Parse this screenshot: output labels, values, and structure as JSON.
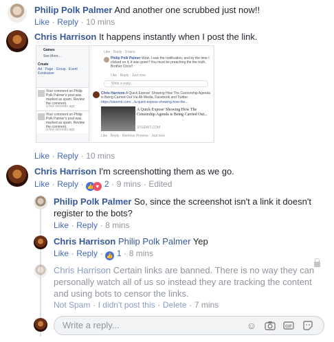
{
  "comments": [
    {
      "author": "Philip Polk Palmer",
      "text": "And another one scrubbed just now!!",
      "like": "Like",
      "reply": "Reply",
      "sep": "·",
      "time": "10 mins"
    },
    {
      "author": "Chris Harrison",
      "text": "It happens instantly when I post the link.",
      "like": "Like",
      "reply": "Reply",
      "sep": "·",
      "time": "10 mins"
    },
    {
      "author": "Chris Harrison",
      "text": "I'm screenshotting them as we go.",
      "like": "Like",
      "reply": "Reply",
      "sep": "·",
      "reactions": "2",
      "time": "9 mins",
      "edited": "Edited"
    }
  ],
  "replies": [
    {
      "author": "Philip Polk Palmer",
      "text_line1": "So, since the screenshot isn't a link it doesn't",
      "text_line2": "register to the bots?",
      "like": "Like",
      "reply": "Reply",
      "sep": "·",
      "time": "8 mins"
    },
    {
      "author": "Chris Harrison",
      "mention": "Philip Polk Palmer",
      "text": "Yep",
      "like": "Like",
      "reply": "Reply",
      "sep": "·",
      "reactions": "1",
      "time": "8 mins"
    },
    {
      "author": "Chris Harrison",
      "text_line1": "Certain links are banned. There is no way they can",
      "text_line2": "personally watch all of us so instead they are tracking the content",
      "text_line3": "and using bots to censor the links.",
      "not_spam": "Not Spam",
      "didnt_post": "I didn't post this",
      "delete": "Delete",
      "sep": "·",
      "time": "7 mins"
    }
  ],
  "reply_box": {
    "placeholder": "Write a reply..."
  },
  "screenshot": {
    "games": "Games",
    "see_more": "See More...",
    "create": "Create",
    "create_links": "Ad · Page · Group · Event",
    "fundraiser": "Fundraiser",
    "notif1": "Your comment on Philip Polk Palmer's post was marked as spam. Review the comment.",
    "notif1_time": "a few seconds ago",
    "notif2": "Your comment on Philip Polk Palmer's post was marked as spam. Review the comment.",
    "notif2_time": "a few seconds ago",
    "c1_meta": "Like · Reply · 9 mins",
    "c2_author": "Philip Polk Palmer",
    "c2_text": "Wow, I saw the notification, and by the time I clicked on it, it was gone!! You must be preaching the the truth, Brother Chris!!",
    "c2_meta": "Like · Reply · Just now",
    "write_reply": "Write a reply...",
    "c3_author": "Chris Harrison",
    "c3_text": "A Quick Expose' Showing How The Censorship Agenda is Being Carried Out Via Alt Media, Facebook and Twitter.",
    "c3_url": "https://steemit.com/.../a-quick-expose-showing-how-the...",
    "card_title": "A Quick Expose' Showing How The Censorship Agenda is Being Carried Out...",
    "card_domain": "STEEMIT.COM",
    "c3_meta": "Like · Reply · Remove Preview · Just now"
  }
}
